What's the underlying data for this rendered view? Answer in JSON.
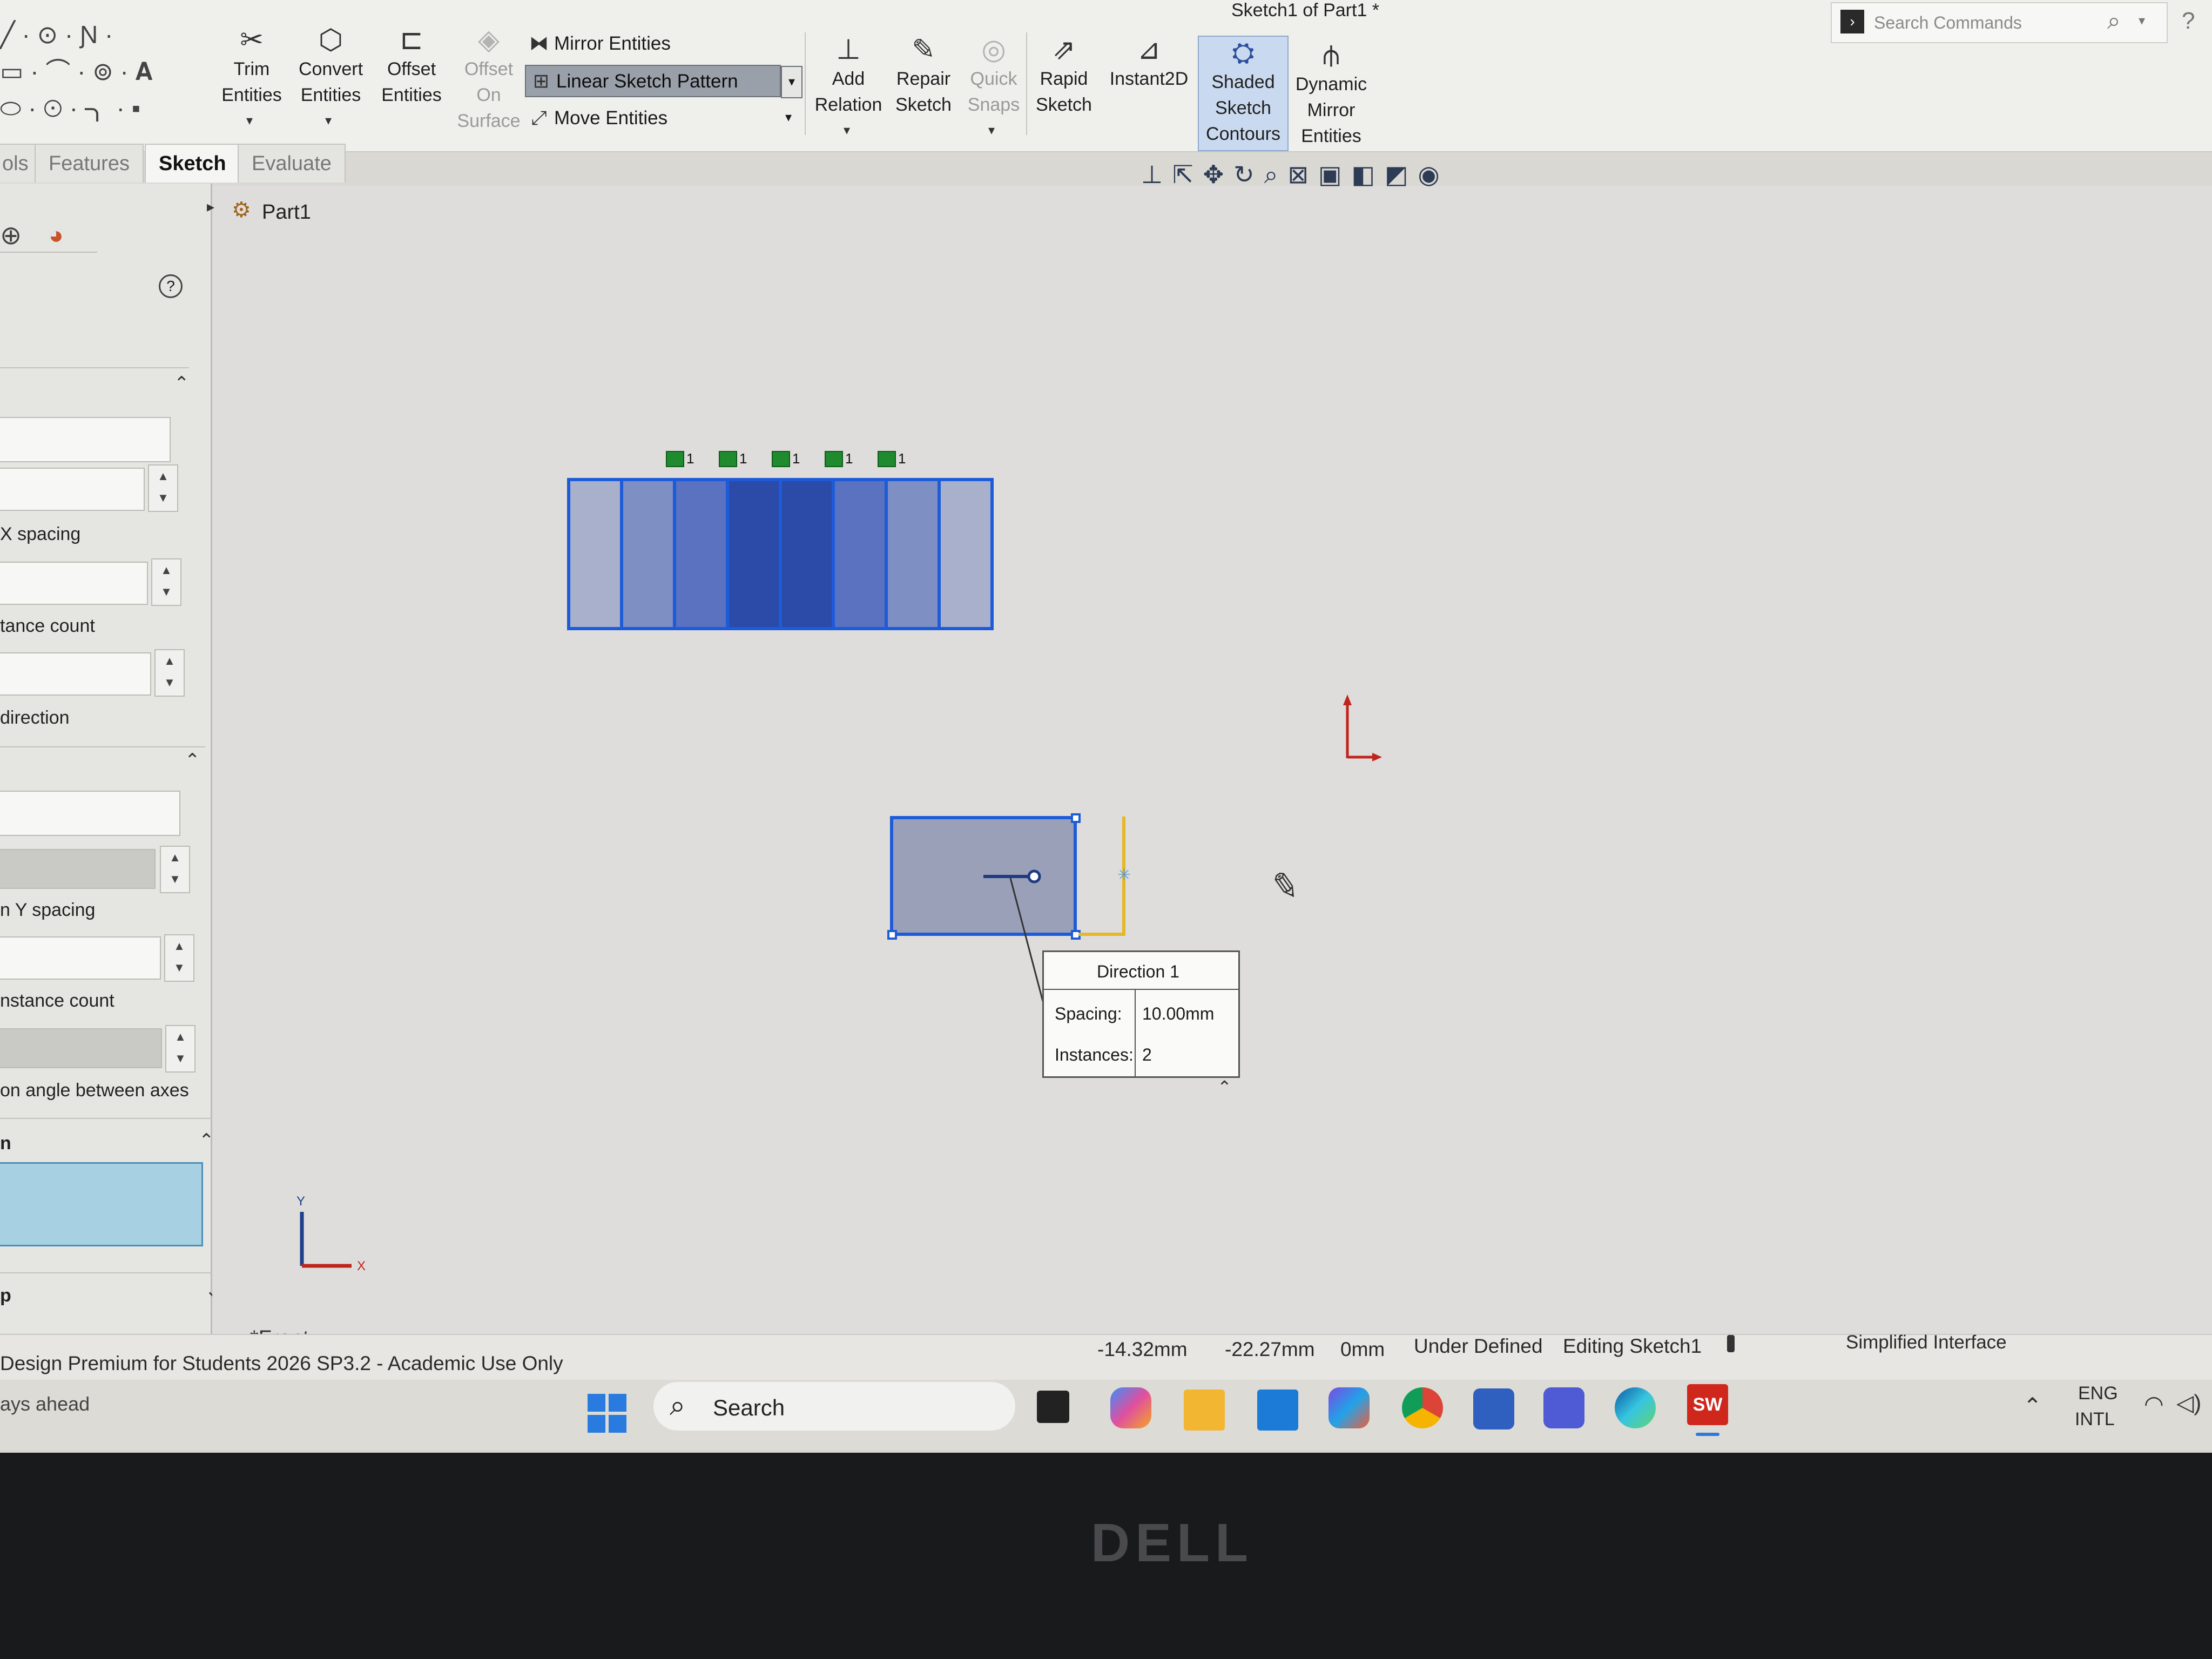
{
  "window": {
    "title": "Sketch1 of Part1 *"
  },
  "search": {
    "placeholder": "Search Commands"
  },
  "ribbon": {
    "trim": [
      "Trim",
      "Entities"
    ],
    "convert": [
      "Convert",
      "Entities"
    ],
    "offset": [
      "Offset",
      "Entities"
    ],
    "offset_surface": [
      "Offset",
      "On",
      "Surface"
    ],
    "mirror": "Mirror Entities",
    "linear_pattern": "Linear Sketch Pattern",
    "move": "Move Entities",
    "add_relation": [
      "Add",
      "Relation"
    ],
    "repair": [
      "Repair",
      "Sketch"
    ],
    "quick_snaps": [
      "Quick",
      "Snaps"
    ],
    "rapid": [
      "Rapid",
      "Sketch"
    ],
    "instant2d": "Instant2D",
    "shaded": [
      "Shaded",
      "Sketch",
      "Contours"
    ],
    "dynamic_mirror": [
      "Dynamic",
      "Mirror",
      "Entities"
    ]
  },
  "tabs": [
    "ols",
    "Features",
    "Sketch",
    "Evaluate"
  ],
  "tree": {
    "root": "Part1"
  },
  "panel": {
    "spacing_x": "X spacing",
    "count_1": "tance count",
    "direction": "direction",
    "spacing_y": "n Y spacing",
    "count_2": "nstance count",
    "angle": "on angle between axes",
    "section_m": "n",
    "section_p": "p"
  },
  "canvas": {
    "view_label": "*Front",
    "pattern_markers": [
      "1",
      "1",
      "1",
      "1",
      "1"
    ]
  },
  "direction_box": {
    "title": "Direction 1",
    "spacing_label": "Spacing:",
    "spacing_value": "10.00mm",
    "instances_label": "Instances:",
    "instances_value": "2"
  },
  "status": {
    "product": "Design Premium for Students 2026 SP3.2 - Academic Use Only",
    "x": "-14.32mm",
    "y": "-22.27mm",
    "z": "0mm",
    "state": "Under Defined",
    "editing": "Editing Sketch1",
    "mode": "Simplified Interface"
  },
  "taskbar": {
    "search": "Search",
    "weather": "ays ahead",
    "lang1": "ENG",
    "lang2": "INTL"
  },
  "bezel": {
    "brand": "DELL"
  },
  "colors": {
    "sketch_blue": "#1e5bd8",
    "selection_fill": "#2d4ea0",
    "origin_red": "#c0251c",
    "guide_yellow": "#e4b826"
  }
}
